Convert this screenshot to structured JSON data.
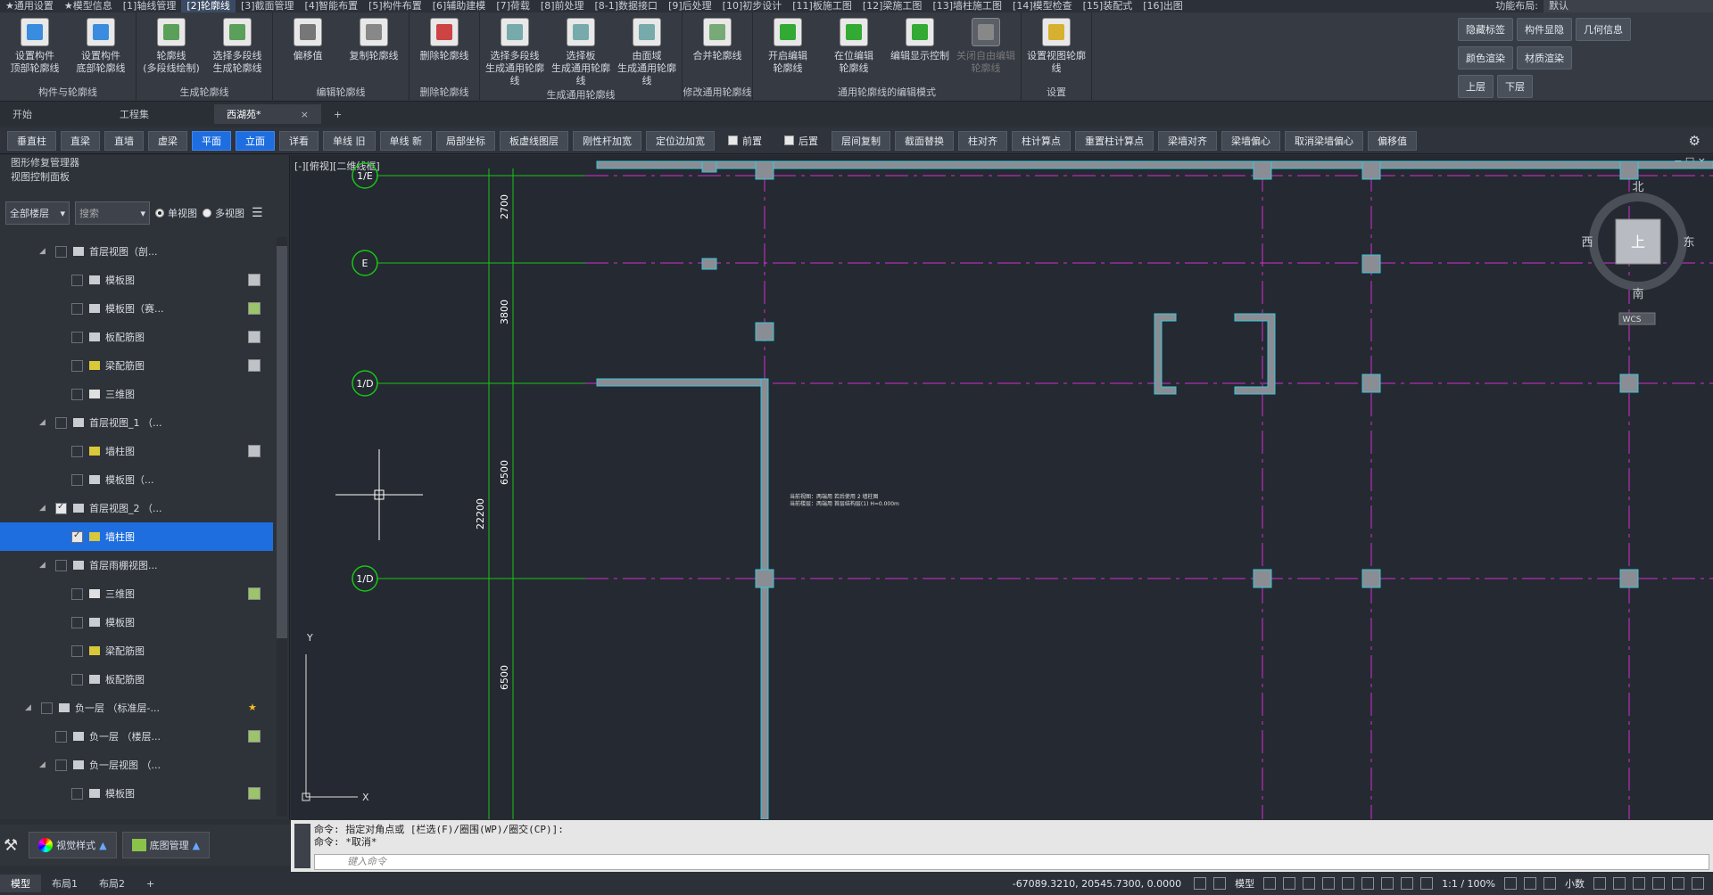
{
  "menu": [
    "★通用设置",
    "★模型信息",
    "[1]轴线管理",
    "[2]轮廓线",
    "[3]截面管理",
    "[4]智能布置",
    "[5]构件布置",
    "[6]辅助建模",
    "[7]荷载",
    "[8]前处理",
    "[8-1]数据接口",
    "[9]后处理",
    "[10]初步设计",
    "[11]板施工图",
    "[12]梁施工图",
    "[13]墙柱施工图",
    "[14]模型检查",
    "[15]装配式",
    "[16]出图"
  ],
  "menu_layout_label": "功能布局:",
  "menu_layout_value": "默认",
  "ribbon": {
    "groups": [
      {
        "title": "构件与轮廓线",
        "buttons": [
          {
            "label": "设置构件\n顶部轮廓线"
          },
          {
            "label": "设置构件\n底部轮廓线"
          }
        ]
      },
      {
        "title": "生成轮廓线",
        "buttons": [
          {
            "label": "轮廓线\n(多段线绘制)"
          },
          {
            "label": "选择多段线\n生成轮廓线"
          }
        ]
      },
      {
        "title": "编辑轮廓线",
        "buttons": [
          {
            "label": "偏移值"
          },
          {
            "label": "复制轮廓线"
          }
        ]
      },
      {
        "title": "删除轮廓线",
        "buttons": [
          {
            "label": "删除轮廓线"
          }
        ]
      },
      {
        "title": "生成通用轮廓线",
        "buttons": [
          {
            "label": "选择多段线\n生成通用轮廓线"
          },
          {
            "label": "选择板\n生成通用轮廓线"
          },
          {
            "label": "由面域\n生成通用轮廓线"
          }
        ]
      },
      {
        "title": "修改通用轮廓线",
        "buttons": [
          {
            "label": "合并轮廓线"
          }
        ]
      },
      {
        "title": "通用轮廓线的编辑模式",
        "buttons": [
          {
            "label": "开启编辑\n轮廓线"
          },
          {
            "label": "在位编辑\n轮廓线"
          },
          {
            "label": "编辑显示控制"
          },
          {
            "label": "关闭自由编辑\n轮廓线",
            "disabled": true
          }
        ]
      },
      {
        "title": "设置",
        "buttons": [
          {
            "label": "设置视图轮廓线"
          }
        ]
      }
    ],
    "right": {
      "row1": [
        "隐藏标签",
        "构件显隐",
        "几何信息"
      ],
      "row2": [
        "颜色渲染",
        "材质渲染"
      ],
      "row3": [
        "上层",
        "下层"
      ]
    }
  },
  "tabs": [
    {
      "label": "开始"
    },
    {
      "label": "工程集"
    },
    {
      "label": "西湖苑*",
      "active": true,
      "close": "×"
    }
  ],
  "tab_add": "+",
  "toolbar": [
    "垂直柱",
    "直梁",
    "直墙",
    "虚梁",
    "平面",
    "立面",
    "详看",
    "单线 旧",
    "单线 新",
    "局部坐标",
    "板虚线图层",
    "刚性杆加宽",
    "定位边加宽",
    "前置",
    "后置",
    "层间复制",
    "截面替换",
    "柱对齐",
    "柱计算点",
    "重置柱计算点",
    "梁墙对齐",
    "梁墙偏心",
    "取消梁墙偏心",
    "偏移值"
  ],
  "toolbar_selected": [
    "平面",
    "立面"
  ],
  "toolbar_checkboxes": [
    "前置",
    "后置"
  ],
  "panel": {
    "title1": "图形修复管理器",
    "title2": "视图控制面板",
    "floor_select": "全部楼层",
    "search_placeholder": "搜索",
    "single_view": "单视图",
    "multi_view": "多视图"
  },
  "tree": [
    {
      "label": "首层视图（剖...",
      "level": 1,
      "exp": "◢",
      "icon": "grid"
    },
    {
      "label": "模板图",
      "level": 2,
      "icon": "grid",
      "ricon": "gray"
    },
    {
      "label": "模板图（赛...",
      "level": 2,
      "icon": "grid",
      "ricon": "green"
    },
    {
      "label": "板配筋图",
      "level": 2,
      "icon": "grid",
      "ricon": "gray"
    },
    {
      "label": "梁配筋图",
      "level": 2,
      "icon": "yellow",
      "ricon": "gray"
    },
    {
      "label": "三维图",
      "level": 2,
      "icon": "cube"
    },
    {
      "label": "首层视图_1 （...",
      "level": 1,
      "exp": "◢",
      "icon": "grid"
    },
    {
      "label": "墙柱图",
      "level": 2,
      "icon": "yellow",
      "ricon": "gray"
    },
    {
      "label": "模板图（...",
      "level": 2,
      "icon": "grid"
    },
    {
      "label": "首层视图_2 （...",
      "level": 1,
      "exp": "◢",
      "icon": "grid",
      "checked": true
    },
    {
      "label": "墙柱图",
      "level": 2,
      "icon": "yellow",
      "checked": true,
      "selected": true
    },
    {
      "label": "首层雨棚视图...",
      "level": 1,
      "exp": "◢",
      "icon": "grid"
    },
    {
      "label": "三维图",
      "level": 2,
      "icon": "cube",
      "ricon": "green"
    },
    {
      "label": "模板图",
      "level": 2,
      "icon": "grid"
    },
    {
      "label": "梁配筋图",
      "level": 2,
      "icon": "yellow"
    },
    {
      "label": "板配筋图",
      "level": 2,
      "icon": "grid"
    },
    {
      "label": "负一层 （标准层-...",
      "level": 0,
      "exp": "◢",
      "icon": "floor",
      "ricon": "star"
    },
    {
      "label": "负一层 （楼层...",
      "level": 1,
      "icon": "list",
      "ricon": "green"
    },
    {
      "label": "负一层视图 （...",
      "level": 1,
      "exp": "◢",
      "icon": "grid"
    },
    {
      "label": "模板图",
      "level": 2,
      "icon": "grid",
      "ricon": "green"
    }
  ],
  "bottom_buttons": [
    "视觉样式",
    "底图管理"
  ],
  "canvas": {
    "view_label": "[-][俯视][二维线框]",
    "axes": [
      "1/E",
      "E",
      "1/D",
      "1/D"
    ],
    "dims": [
      "2700",
      "3800",
      "6500",
      "22200",
      "6500"
    ],
    "compass": {
      "n": "北",
      "s": "南",
      "e": "东",
      "w": "西",
      "top": "上",
      "wcs": "WCS"
    },
    "note1": "当前视图：两端用  若后使用 2 墙柱图",
    "note2": "当前楼层：两端用  首层结构层(1) H=0.000m",
    "ucs_x": "X",
    "ucs_y": "Y",
    "win_controls": "− □ ×"
  },
  "command": {
    "line1": "命令: 指定对角点或 [栏选(F)/圈围(WP)/圈交(CP)]:",
    "line2": "命令: *取消*",
    "placeholder": "键入命令"
  },
  "status": {
    "tabs": [
      "模型",
      "布局1",
      "布局2"
    ],
    "add": "+",
    "coords": "-67089.3210, 20545.7300, 0.0000",
    "model": "模型",
    "scale": "1:1 / 100%",
    "units": "小数"
  }
}
